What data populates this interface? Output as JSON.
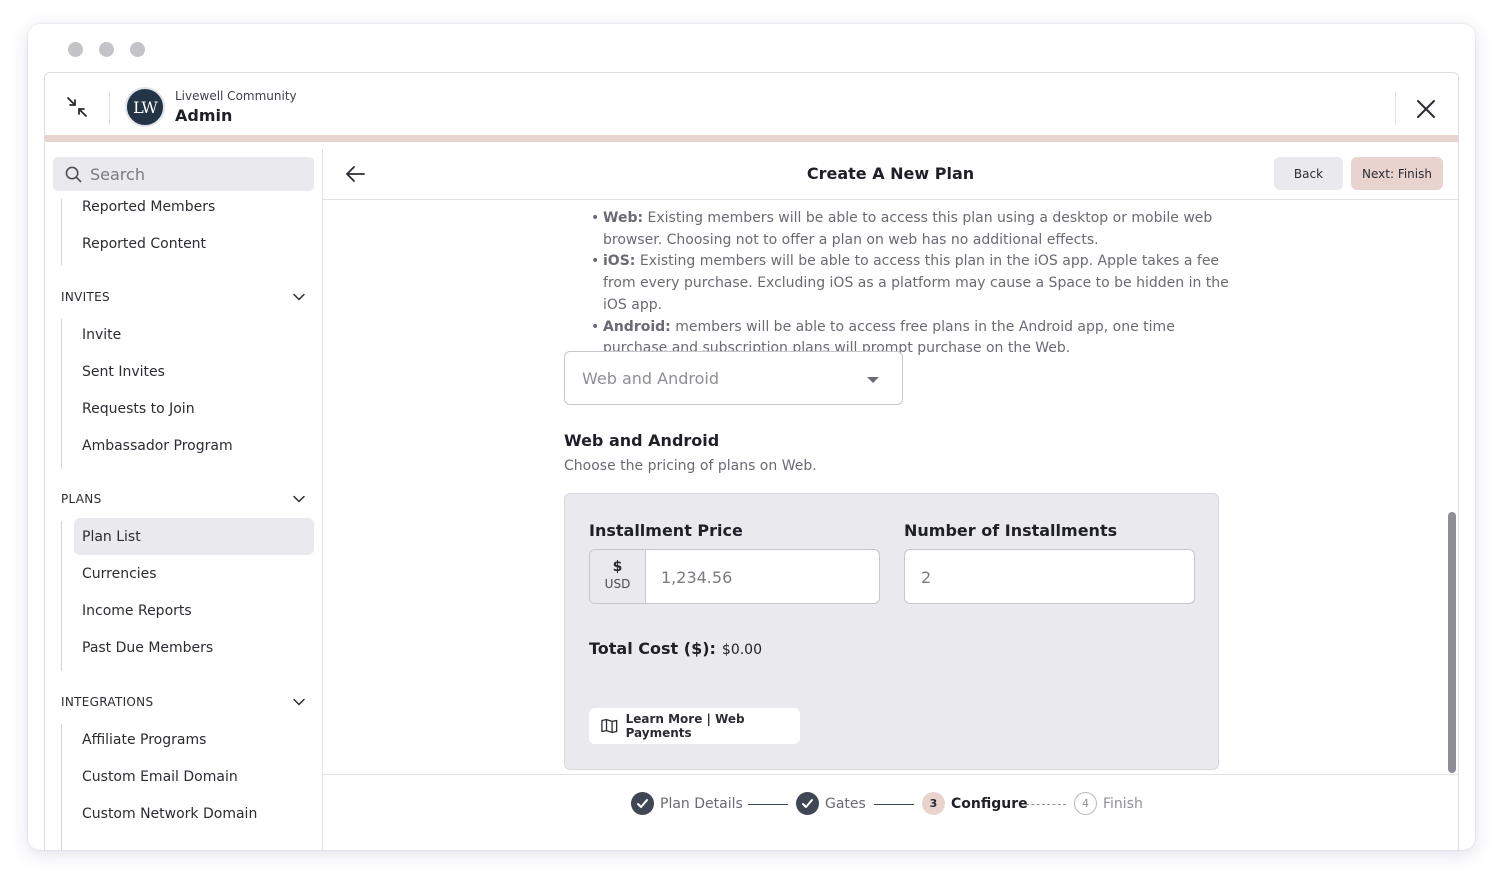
{
  "app": {
    "community_name": "Livewell Community",
    "role_label": "Admin",
    "logo_text": "LW"
  },
  "sidebar": {
    "search_placeholder": "Search",
    "top_items": [
      "Reported Members",
      "Reported Content"
    ],
    "sections": [
      {
        "title": "INVITES",
        "items": [
          "Invite",
          "Sent Invites",
          "Requests to Join",
          "Ambassador Program"
        ]
      },
      {
        "title": "PLANS",
        "items": [
          "Plan List",
          "Currencies",
          "Income Reports",
          "Past Due Members"
        ],
        "active": "Plan List"
      },
      {
        "title": "INTEGRATIONS",
        "items": [
          "Affiliate Programs",
          "Custom Email Domain",
          "Custom Network Domain"
        ]
      }
    ]
  },
  "header": {
    "title": "Create A New Plan",
    "back_label": "Back",
    "next_label": "Next: Finish"
  },
  "platforms": {
    "bullets": [
      {
        "term": "Web:",
        "text": "Existing members will be able to access this plan using a desktop or mobile web browser. Choosing not to offer a plan on web has no additional effects."
      },
      {
        "term": "iOS:",
        "text": "Existing members will be able to access this plan in the iOS app. Apple takes a fee from every purchase. Excluding iOS as a platform may cause a Space to be hidden in the iOS app."
      },
      {
        "term": "Android:",
        "text": "members will be able to access free plans in the Android app, one time purchase and subscription plans will prompt purchase on the Web."
      }
    ],
    "select_value": "Web and Android"
  },
  "pricing": {
    "title": "Web and Android",
    "description": "Choose the pricing of plans on Web.",
    "installment_price_label": "Installment Price",
    "currency_symbol": "$",
    "currency_code": "USD",
    "installment_price_placeholder": "1,234.56",
    "installments_label": "Number of Installments",
    "installments_value": "2",
    "total_label": "Total Cost ($):",
    "total_value": "$0.00",
    "learn_more_label": "Learn More | Web Payments"
  },
  "stepper": {
    "steps": [
      {
        "label": "Plan Details",
        "state": "done"
      },
      {
        "label": "Gates",
        "state": "done"
      },
      {
        "label": "Configure",
        "state": "current",
        "number": "3"
      },
      {
        "label": "Finish",
        "state": "future",
        "number": "4"
      }
    ]
  },
  "colors": {
    "accent": "#e9d3cf",
    "dark": "#3f4654",
    "panel": "#e9e9ee"
  }
}
